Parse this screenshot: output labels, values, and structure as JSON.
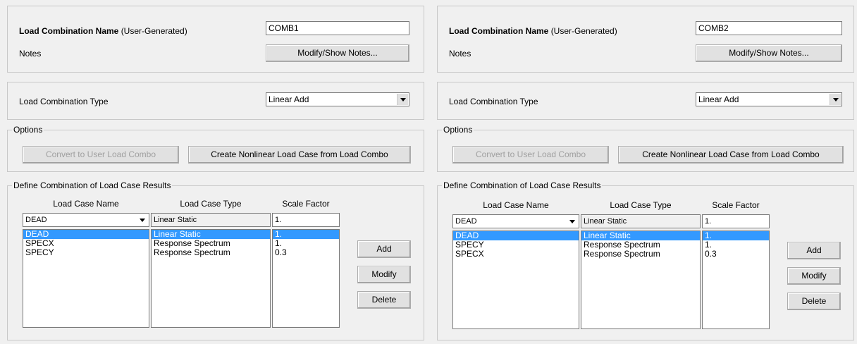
{
  "panels": [
    {
      "name_label_bold": "Load Combination Name",
      "name_label_suffix": "(User-Generated)",
      "name_value": "COMB1",
      "notes_label": "Notes",
      "notes_button": "Modify/Show Notes...",
      "type_label": "Load Combination Type",
      "type_value": "Linear Add",
      "options_title": "Options",
      "convert_button": "Convert to User Load Combo",
      "create_button": "Create Nonlinear Load Case from Load Combo",
      "define_title": "Define Combination of Load Case Results",
      "col_case_name": "Load Case Name",
      "col_case_type": "Load Case Type",
      "col_scale": "Scale Factor",
      "edit_case_name": "DEAD",
      "edit_case_type": "Linear Static",
      "edit_scale": "1.",
      "rows": [
        {
          "name": "DEAD",
          "type": "Linear Static",
          "scale": "1."
        },
        {
          "name": "SPECX",
          "type": "Response Spectrum",
          "scale": "1."
        },
        {
          "name": "SPECY",
          "type": "Response Spectrum",
          "scale": "0.3"
        }
      ],
      "add_button": "Add",
      "modify_button": "Modify",
      "delete_button": "Delete"
    },
    {
      "name_label_bold": "Load Combination Name",
      "name_label_suffix": "(User-Generated)",
      "name_value": "COMB2",
      "notes_label": "Notes",
      "notes_button": "Modify/Show Notes...",
      "type_label": "Load Combination Type",
      "type_value": "Linear Add",
      "options_title": "Options",
      "convert_button": "Convert to User Load Combo",
      "create_button": "Create Nonlinear Load Case from Load Combo",
      "define_title": "Define Combination of Load Case Results",
      "col_case_name": "Load Case Name",
      "col_case_type": "Load Case Type",
      "col_scale": "Scale Factor",
      "edit_case_name": "DEAD",
      "edit_case_type": "Linear Static",
      "edit_scale": "1.",
      "rows": [
        {
          "name": "DEAD",
          "type": "Linear Static",
          "scale": "1."
        },
        {
          "name": "SPECY",
          "type": "Response Spectrum",
          "scale": "1."
        },
        {
          "name": "SPECX",
          "type": "Response Spectrum",
          "scale": "0.3"
        }
      ],
      "add_button": "Add",
      "modify_button": "Modify",
      "delete_button": "Delete"
    }
  ]
}
